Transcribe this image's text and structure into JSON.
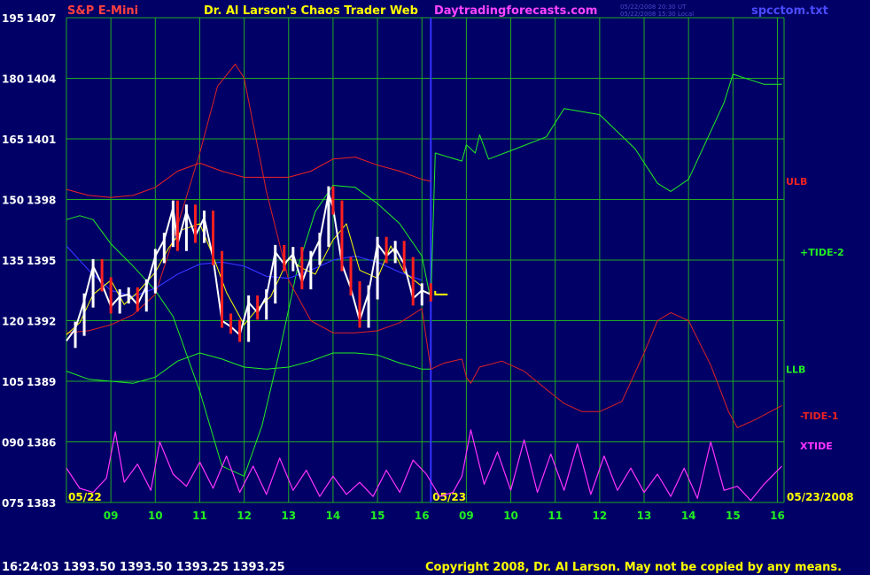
{
  "header": {
    "symbol": "S&P E-Mini",
    "title": "Dr. Al Larson's Chaos Trader Web",
    "site": "Daytradingforecasts.com",
    "stamp1": "05/22/2008 20:30 UT",
    "stamp2": "05/22/2008 15:30 Local",
    "file": "spcctom.txt"
  },
  "footer": {
    "quote": "16:24:03  1393.50  1393.50  1393.25  1393.25",
    "copyright": "Copyright 2008, Dr. Al Larson. May not be copied by any means."
  },
  "colors": {
    "background": "#000066",
    "grid": "#22aa22",
    "axis_text": "#ffffff",
    "price_up": "#ffffff",
    "price_down": "#ff2020",
    "ulb_llb": "#ee2222",
    "tide2": "#22ee22",
    "tide1": "#dd2222",
    "xtide": "#ff33ff",
    "now_line": "#3333ff",
    "blue_ma": "#3333ff",
    "yellow_ma": "#ffff00"
  },
  "chart_data": {
    "type": "line",
    "title": "S&P E-Mini",
    "y_axis_left_labels": [
      "195",
      "180",
      "165",
      "150",
      "135",
      "120",
      "105",
      "090",
      "075"
    ],
    "y_axis_price_labels": [
      "1407",
      "1404",
      "1401",
      "1398",
      "1395",
      "1392",
      "1389",
      "1386",
      "1383"
    ],
    "y_price_range": [
      1383,
      1407
    ],
    "x_hour_labels": [
      "09",
      "10",
      "11",
      "12",
      "13",
      "14",
      "15",
      "16",
      "09",
      "10",
      "11",
      "12",
      "13",
      "14",
      "15",
      "16"
    ],
    "date_labels": [
      "05/22",
      "05/23",
      "05/23/2008"
    ],
    "legend": [
      {
        "name": "ULB",
        "color": "#ee2222"
      },
      {
        "name": "+TIDE-2",
        "color": "#22ee22"
      },
      {
        "name": "LLB",
        "color": "#22ee22"
      },
      {
        "name": "-TIDE-1",
        "color": "#ee2222"
      },
      {
        "name": "XTIDE",
        "color": "#ff33ff"
      }
    ],
    "grid": true,
    "series": [
      {
        "name": "ULB",
        "x": [
          8.0,
          8.5,
          9.0,
          9.5,
          10.0,
          10.5,
          11.0,
          11.5,
          12.0,
          12.5,
          13.0,
          13.5,
          14.0,
          14.5,
          15.0,
          15.5,
          16.0,
          16.2
        ],
        "y": [
          1398.5,
          1398.2,
          1398.1,
          1398.2,
          1398.6,
          1399.4,
          1399.8,
          1399.4,
          1399.1,
          1399.1,
          1399.1,
          1399.4,
          1400.0,
          1400.1,
          1399.7,
          1399.4,
          1399.0,
          1398.9
        ]
      },
      {
        "name": "LLB",
        "x": [
          8.0,
          8.5,
          9.0,
          9.5,
          10.0,
          10.5,
          11.0,
          11.5,
          12.0,
          12.5,
          13.0,
          13.5,
          14.0,
          14.5,
          15.0,
          15.5,
          16.0,
          16.2
        ],
        "y": [
          1389.5,
          1389.1,
          1389.0,
          1388.9,
          1389.2,
          1390.0,
          1390.4,
          1390.1,
          1389.7,
          1389.6,
          1389.7,
          1390.0,
          1390.4,
          1390.4,
          1390.3,
          1389.9,
          1389.6,
          1389.6
        ]
      },
      {
        "name": "+TIDE-2",
        "x": [
          8.0,
          8.3,
          8.6,
          9.0,
          9.5,
          10.0,
          10.4,
          11.0,
          11.5,
          12.0,
          12.4,
          12.8,
          13.2,
          13.6,
          14.0,
          14.5,
          15.0,
          15.5,
          16.0,
          16.2,
          16.3,
          16.9,
          17.0,
          17.2,
          17.3,
          17.5,
          18.1,
          18.8,
          19.2,
          20.0,
          20.8,
          21.3,
          21.6,
          22.0,
          22.8,
          23.0,
          23.7,
          24.1
        ],
        "y": [
          1397.0,
          1397.2,
          1397.0,
          1395.8,
          1394.7,
          1393.5,
          1392.2,
          1388.5,
          1384.8,
          1384.3,
          1386.8,
          1390.5,
          1394.6,
          1397.4,
          1398.7,
          1398.6,
          1397.8,
          1396.8,
          1395.2,
          1393.0,
          1400.3,
          1399.9,
          1400.7,
          1400.3,
          1401.2,
          1400.0,
          1400.5,
          1401.1,
          1402.5,
          1402.2,
          1400.5,
          1398.8,
          1398.4,
          1399.0,
          1402.8,
          1404.2,
          1403.7,
          1403.7
        ]
      },
      {
        "name": "-TIDE-1",
        "x": [
          8.0,
          8.5,
          9.0,
          9.5,
          10.0,
          10.5,
          11.0,
          11.4,
          11.8,
          12.0,
          12.5,
          13.0,
          13.5,
          14.0,
          14.5,
          15.0,
          15.5,
          16.0,
          16.2,
          16.5,
          16.9,
          17.0,
          17.1,
          17.3,
          17.8,
          18.3,
          18.8,
          19.2,
          19.6,
          20.0,
          20.5,
          21.0,
          21.3,
          21.6,
          22.0,
          22.5,
          22.9,
          23.1,
          23.5,
          24.1
        ],
        "y": [
          1391.4,
          1391.5,
          1391.8,
          1392.3,
          1393.3,
          1396.7,
          1400.3,
          1403.6,
          1404.7,
          1404.0,
          1398.4,
          1394.0,
          1392.0,
          1391.4,
          1391.4,
          1391.5,
          1391.9,
          1392.6,
          1389.6,
          1389.9,
          1390.1,
          1389.2,
          1388.9,
          1389.7,
          1390.0,
          1389.5,
          1388.6,
          1387.9,
          1387.5,
          1387.5,
          1388.0,
          1390.4,
          1392.0,
          1392.4,
          1392.0,
          1389.8,
          1387.5,
          1386.7,
          1387.1,
          1387.8
        ]
      },
      {
        "name": "XTIDE",
        "x": [
          8.0,
          8.3,
          8.6,
          8.9,
          9.1,
          9.3,
          9.6,
          9.9,
          10.1,
          10.4,
          10.7,
          11.0,
          11.3,
          11.6,
          11.9,
          12.2,
          12.5,
          12.8,
          13.1,
          13.4,
          13.7,
          14.0,
          14.3,
          14.6,
          14.9,
          15.2,
          15.5,
          15.8,
          16.1,
          16.4,
          16.7,
          16.9,
          17.1,
          17.4,
          17.7,
          18.0,
          18.3,
          18.6,
          18.9,
          19.2,
          19.5,
          19.8,
          20.1,
          20.4,
          20.7,
          21.0,
          21.3,
          21.6,
          21.9,
          22.2,
          22.5,
          22.8,
          23.1,
          23.4,
          23.7,
          24.1
        ],
        "y": [
          1384.7,
          1383.7,
          1383.5,
          1384.2,
          1386.5,
          1384.0,
          1384.9,
          1383.6,
          1386.0,
          1384.4,
          1383.8,
          1385.0,
          1383.7,
          1385.3,
          1383.5,
          1384.8,
          1383.4,
          1385.2,
          1383.6,
          1384.6,
          1383.3,
          1384.3,
          1383.4,
          1384.0,
          1383.3,
          1384.6,
          1383.5,
          1385.1,
          1384.4,
          1383.3,
          1383.5,
          1384.3,
          1386.6,
          1383.9,
          1385.5,
          1383.6,
          1386.1,
          1383.5,
          1385.4,
          1383.6,
          1385.9,
          1383.4,
          1385.3,
          1383.6,
          1384.7,
          1383.5,
          1384.4,
          1383.3,
          1384.7,
          1383.2,
          1386.0,
          1383.6,
          1383.8,
          1383.1,
          1383.9,
          1384.8
        ]
      },
      {
        "name": "Blue MA",
        "x": [
          8.0,
          8.5,
          9.0,
          9.5,
          10.0,
          10.5,
          11.0,
          11.5,
          12.0,
          12.5,
          13.0,
          13.5,
          14.0,
          14.5,
          15.0,
          15.5,
          16.0
        ],
        "y": [
          1395.7,
          1394.5,
          1393.5,
          1393.2,
          1393.6,
          1394.3,
          1394.8,
          1394.9,
          1394.7,
          1394.2,
          1394.1,
          1394.5,
          1395.0,
          1395.2,
          1394.9,
          1394.4,
          1394.0
        ]
      },
      {
        "name": "Yellow MA",
        "x": [
          8.0,
          8.3,
          8.6,
          9.0,
          9.3,
          9.6,
          10.0,
          10.3,
          10.6,
          11.0,
          11.3,
          11.6,
          12.0,
          12.3,
          12.6,
          13.0,
          13.3,
          13.6,
          14.0,
          14.3,
          14.6,
          15.0,
          15.3,
          15.6,
          16.0
        ],
        "y": [
          1391.3,
          1391.9,
          1393.3,
          1394.0,
          1392.8,
          1393.4,
          1394.4,
          1395.6,
          1396.5,
          1396.8,
          1395.2,
          1393.4,
          1391.8,
          1392.6,
          1393.2,
          1395.1,
          1394.6,
          1394.3,
          1396.0,
          1396.8,
          1394.5,
          1394.1,
          1395.7,
          1394.4,
          1393.7
        ]
      },
      {
        "name": "Price",
        "x": [
          8.0,
          8.2,
          8.4,
          8.6,
          8.8,
          9.0,
          9.2,
          9.4,
          9.6,
          9.8,
          10.0,
          10.2,
          10.4,
          10.5,
          10.7,
          10.9,
          11.1,
          11.3,
          11.5,
          11.7,
          11.9,
          12.1,
          12.3,
          12.5,
          12.7,
          12.9,
          13.1,
          13.3,
          13.5,
          13.7,
          13.9,
          14.0,
          14.2,
          14.4,
          14.6,
          14.8,
          15.0,
          15.2,
          15.4,
          15.6,
          15.8,
          16.0,
          16.2
        ],
        "y": [
          1391.0,
          1391.6,
          1393.0,
          1394.7,
          1393.8,
          1392.7,
          1393.2,
          1393.3,
          1392.8,
          1393.7,
          1395.2,
          1396.0,
          1397.6,
          1395.8,
          1397.4,
          1396.2,
          1397.1,
          1395.1,
          1392.0,
          1391.7,
          1391.3,
          1392.9,
          1392.4,
          1393.2,
          1395.4,
          1394.8,
          1395.3,
          1393.9,
          1395.1,
          1396.0,
          1398.3,
          1397.6,
          1394.8,
          1393.6,
          1392.0,
          1393.4,
          1395.8,
          1395.2,
          1395.6,
          1394.8,
          1393.1,
          1393.5,
          1393.3
        ]
      }
    ]
  }
}
